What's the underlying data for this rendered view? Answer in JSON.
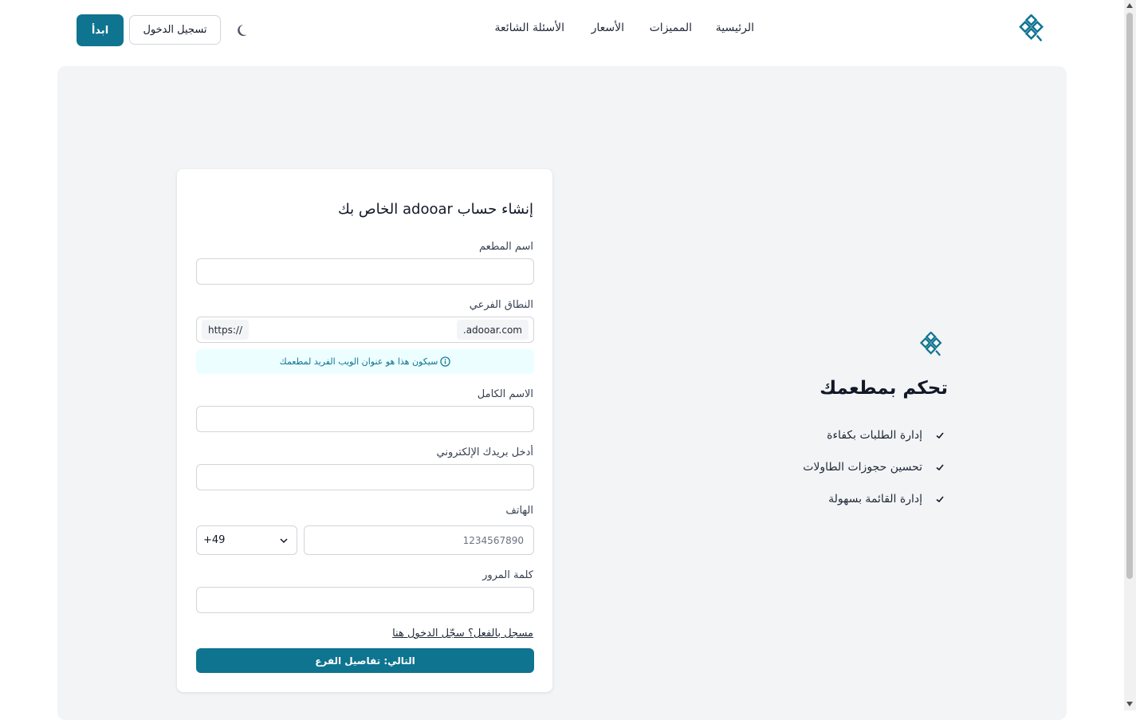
{
  "header": {
    "nav": [
      "الرئيسية",
      "المميزات",
      "الأسعار",
      "الأسئلة الشائعة"
    ],
    "login_label": "تسجيل الدخول",
    "start_label": "ابدأ"
  },
  "promo": {
    "title": "تحكم بمطعمك",
    "features": [
      "إدارة الطلبات بكفاءة",
      "تحسين حجوزات الطاولات",
      "إدارة القائمة بسهولة"
    ]
  },
  "form": {
    "title": "إنشاء حساب adooar الخاص بك",
    "restaurant_label": "اسم المطعم",
    "subdomain_label": "النطاق الفرعي",
    "https_prefix": "https://",
    "domain_suffix": ".adooar.com",
    "subdomain_hint": "سيكون هذا هو عنوان الويب الفريد لمطعمك",
    "fullname_label": "الاسم الكامل",
    "email_label": "أدخل بريدك الإلكتروني",
    "phone_label": "الهاتف",
    "country_code": "+49",
    "phone_placeholder": "1234567890",
    "password_label": "كلمة المرور",
    "login_link": "مسجل بالفعل؟ سجّل الدخول هنا",
    "next_button": "التالي: تفاصيل الفرع"
  },
  "colors": {
    "primary": "#0e7490",
    "panel": "#f3f4f6",
    "hint_bg": "#ecfeff"
  }
}
